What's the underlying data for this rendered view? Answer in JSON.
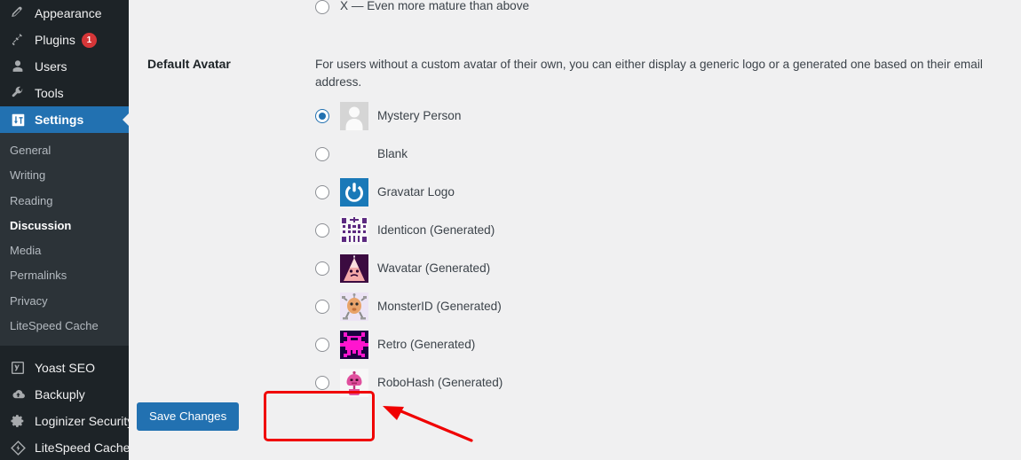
{
  "sidebar": {
    "items": [
      {
        "label": "Appearance",
        "icon": "appearance-brush-icon",
        "current": false,
        "badge": null
      },
      {
        "label": "Plugins",
        "icon": "plugins-plug-icon",
        "current": false,
        "badge": "1"
      },
      {
        "label": "Users",
        "icon": "users-person-icon",
        "current": false,
        "badge": null
      },
      {
        "label": "Tools",
        "icon": "tools-wrench-icon",
        "current": false,
        "badge": null
      },
      {
        "label": "Settings",
        "icon": "settings-sliders-icon",
        "current": true,
        "badge": null
      }
    ],
    "submenu": [
      {
        "label": "General",
        "current": false
      },
      {
        "label": "Writing",
        "current": false
      },
      {
        "label": "Reading",
        "current": false
      },
      {
        "label": "Discussion",
        "current": true
      },
      {
        "label": "Media",
        "current": false
      },
      {
        "label": "Permalinks",
        "current": false
      },
      {
        "label": "Privacy",
        "current": false
      },
      {
        "label": "LiteSpeed Cache",
        "current": false
      }
    ],
    "plugin_items": [
      {
        "label": "Yoast SEO",
        "icon": "yoast-seo-icon"
      },
      {
        "label": "Backuply",
        "icon": "backuply-cloud-icon"
      },
      {
        "label": "Loginizer Security",
        "icon": "loginizer-gear-icon"
      },
      {
        "label": "LiteSpeed Cache",
        "icon": "litespeed-diamond-icon"
      }
    ],
    "colors": {
      "background": "#1d2327",
      "submenu_background": "#2c3338",
      "current_highlight": "#2271b1",
      "badge": "#d63638"
    }
  },
  "main": {
    "maturity_option": {
      "label": "X — Even more mature than above",
      "checked": false
    },
    "default_avatar": {
      "section_title": "Default Avatar",
      "description": "For users without a custom avatar of their own, you can either display a generic logo or a generated one based on their email address.",
      "options": [
        {
          "label": "Mystery Person",
          "avatar": "mystery-person-avatar",
          "checked": true
        },
        {
          "label": "Blank",
          "avatar": "blank-avatar",
          "checked": false
        },
        {
          "label": "Gravatar Logo",
          "avatar": "gravatar-logo-avatar",
          "checked": false
        },
        {
          "label": "Identicon (Generated)",
          "avatar": "identicon-avatar",
          "checked": false
        },
        {
          "label": "Wavatar (Generated)",
          "avatar": "wavatar-avatar",
          "checked": false
        },
        {
          "label": "MonsterID (Generated)",
          "avatar": "monsterid-avatar",
          "checked": false
        },
        {
          "label": "Retro (Generated)",
          "avatar": "retro-avatar",
          "checked": false
        },
        {
          "label": "RoboHash (Generated)",
          "avatar": "robohash-avatar",
          "checked": false
        }
      ]
    },
    "submit": {
      "save_label": "Save Changes",
      "button_color": "#2271b1"
    }
  },
  "annotation": {
    "highlight_color": "#f00000",
    "shapes": [
      "save-button-highlight-box",
      "pointer-arrow"
    ]
  }
}
